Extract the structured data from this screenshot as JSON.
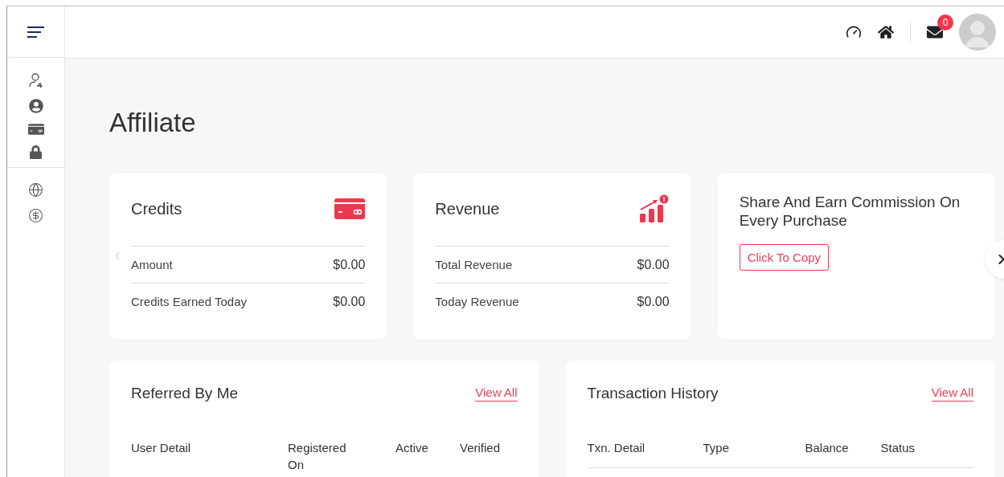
{
  "header": {
    "notifications_badge": "0"
  },
  "page_title": "Affiliate",
  "stat_cards": [
    {
      "title": "Credits",
      "rows": [
        {
          "label": "Amount",
          "value": "$0.00"
        },
        {
          "label": "Credits Earned Today",
          "value": "$0.00"
        }
      ]
    },
    {
      "title": "Revenue",
      "rows": [
        {
          "label": "Total Revenue",
          "value": "$0.00"
        },
        {
          "label": "Today Revenue",
          "value": "$0.00"
        }
      ]
    }
  ],
  "share_card": {
    "title": "Share And Earn Commission On Every Purchase",
    "button": "Click To Copy"
  },
  "panels": [
    {
      "title": "Referred By Me",
      "link": "View All",
      "columns": [
        "User Detail",
        "Registered On",
        "Active",
        "Verified"
      ]
    },
    {
      "title": "Transaction History",
      "link": "View All",
      "columns": [
        "Txn. Detail",
        "Type",
        "Balance",
        "Status"
      ]
    }
  ]
}
